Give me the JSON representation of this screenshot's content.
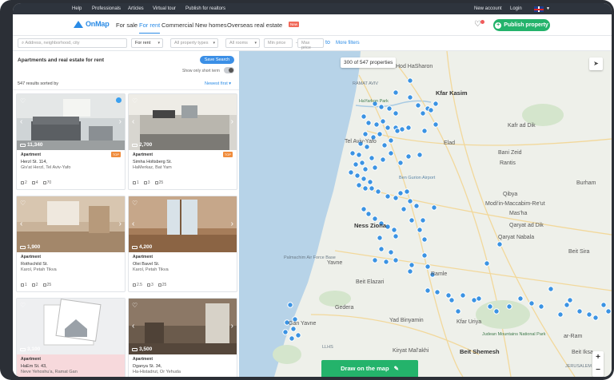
{
  "topbar": {
    "links": [
      "Help",
      "Professionals",
      "Articles",
      "Virtual tour",
      "Publish for realtors"
    ],
    "right_links": [
      "New account",
      "Login"
    ]
  },
  "header": {
    "logo": "OnMap",
    "nav": [
      "For sale",
      "For rent",
      "Commercial",
      "New homes",
      "Overseas real estate"
    ],
    "active_nav": "For rent",
    "new_badge": "New",
    "publish_label": "Publish property"
  },
  "filters": {
    "search_placeholder": "Address, neighborhood, city",
    "deal": "For rent",
    "property_types": "All property types",
    "rooms": "All rooms",
    "min_price": "Min price",
    "max_price": "Max price",
    "to": "to",
    "more": "More filters"
  },
  "panel": {
    "title": "Apartments and real estate for rent",
    "save_search": "Save Search",
    "short_term": "Show only short term",
    "results": "547 results sorted by",
    "sort": "Newest first"
  },
  "cards": [
    {
      "price": "11,340",
      "type": "Apartment",
      "addr1": "Herzl St. 114,",
      "addr2": "Giv'at Herzl, Tel Aviv-Yafo",
      "rooms": "2",
      "baths": "4",
      "size": "70",
      "top": "TOP",
      "verified": true,
      "scene": "living"
    },
    {
      "price": "2,700",
      "type": "Apartment",
      "addr1": "Simha Holtsberg St.",
      "addr2": "HaMerkaz, Bat Yam",
      "rooms": "1",
      "baths": "3",
      "size": "25",
      "top": "TOP",
      "verified": false,
      "scene": "kitchen"
    },
    {
      "price": "1,900",
      "type": "Apartment",
      "addr1": "Rothschild St.",
      "addr2": "Karol, Petah Tikva",
      "rooms": "1",
      "baths": "2",
      "size": "25",
      "top": "",
      "verified": false,
      "scene": "room"
    },
    {
      "price": "4,200",
      "type": "Apartment",
      "addr1": "Olei Bavel St.",
      "addr2": "Karol, Petah Tikva",
      "rooms": "2.5",
      "baths": "3",
      "size": "25",
      "top": "",
      "verified": false,
      "scene": "window"
    },
    {
      "price": "3,100",
      "type": "Apartment",
      "addr1": "HaEm St. 43,",
      "addr2": "Neve Yehoshu'a, Ramat Gan",
      "rooms": "",
      "baths": "",
      "size": "",
      "top": "",
      "verified": false,
      "scene": "placeholder"
    },
    {
      "price": "3,500",
      "type": "Apartment",
      "addr1": "Dganya St. 34,",
      "addr2": "Ha-Histadrut, Or Yehuda",
      "rooms": "",
      "baths": "",
      "size": "",
      "top": "",
      "verified": false,
      "scene": "door"
    }
  ],
  "map": {
    "count": "300 of 547 properties",
    "draw": "Draw on the map",
    "labels": [
      {
        "t": "Hod HaSharon",
        "c": ""
      },
      {
        "t": "Kfar Kasim",
        "c": "big"
      },
      {
        "t": "RAMAT AVIV",
        "c": "sm"
      },
      {
        "t": "HaYarkon Park",
        "c": "green"
      },
      {
        "t": "Kafr ad Dik",
        "c": ""
      },
      {
        "t": "Elad",
        "c": ""
      },
      {
        "t": "Tel Aviv-Yafo",
        "c": ""
      },
      {
        "t": "Bani Zeid",
        "c": ""
      },
      {
        "t": "Rantis",
        "c": ""
      },
      {
        "t": "Ben Gurion Airport",
        "c": "water"
      },
      {
        "t": "Qibya",
        "c": ""
      },
      {
        "t": "Burham",
        "c": ""
      },
      {
        "t": "Modi'in-Maccabim-Re'ut",
        "c": ""
      },
      {
        "t": "Mas'ha",
        "c": ""
      },
      {
        "t": "Qaryat ad Dik",
        "c": ""
      },
      {
        "t": "Ness Ziona",
        "c": "big"
      },
      {
        "t": "Qaryat Nabala",
        "c": ""
      },
      {
        "t": "Beit Sira",
        "c": ""
      },
      {
        "t": "Palmachim Air Force Base",
        "c": "sm"
      },
      {
        "t": "Yavne",
        "c": ""
      },
      {
        "t": "Ramle",
        "c": ""
      },
      {
        "t": "Beit Elazari",
        "c": ""
      },
      {
        "t": "Gedera",
        "c": ""
      },
      {
        "t": "Gan Yavne",
        "c": ""
      },
      {
        "t": "Yad Binyamin",
        "c": ""
      },
      {
        "t": "Kfar Uriya",
        "c": ""
      },
      {
        "t": "LLHS",
        "c": "sm"
      },
      {
        "t": "Kiryat Mal'akhi",
        "c": ""
      },
      {
        "t": "Beit Shemesh",
        "c": "big"
      },
      {
        "t": "Judean Mountains National Park",
        "c": "green"
      },
      {
        "t": "ar-Ram",
        "c": ""
      },
      {
        "t": "Beit Iksa",
        "c": ""
      },
      {
        "t": "JERUSALEM",
        "c": "sm"
      }
    ],
    "pin_color": "#3b93e3"
  },
  "colors": {
    "brand": "#2a8be6",
    "publish": "#24b36b",
    "sea": "#b7d3e8",
    "land": "#eef0ea"
  }
}
